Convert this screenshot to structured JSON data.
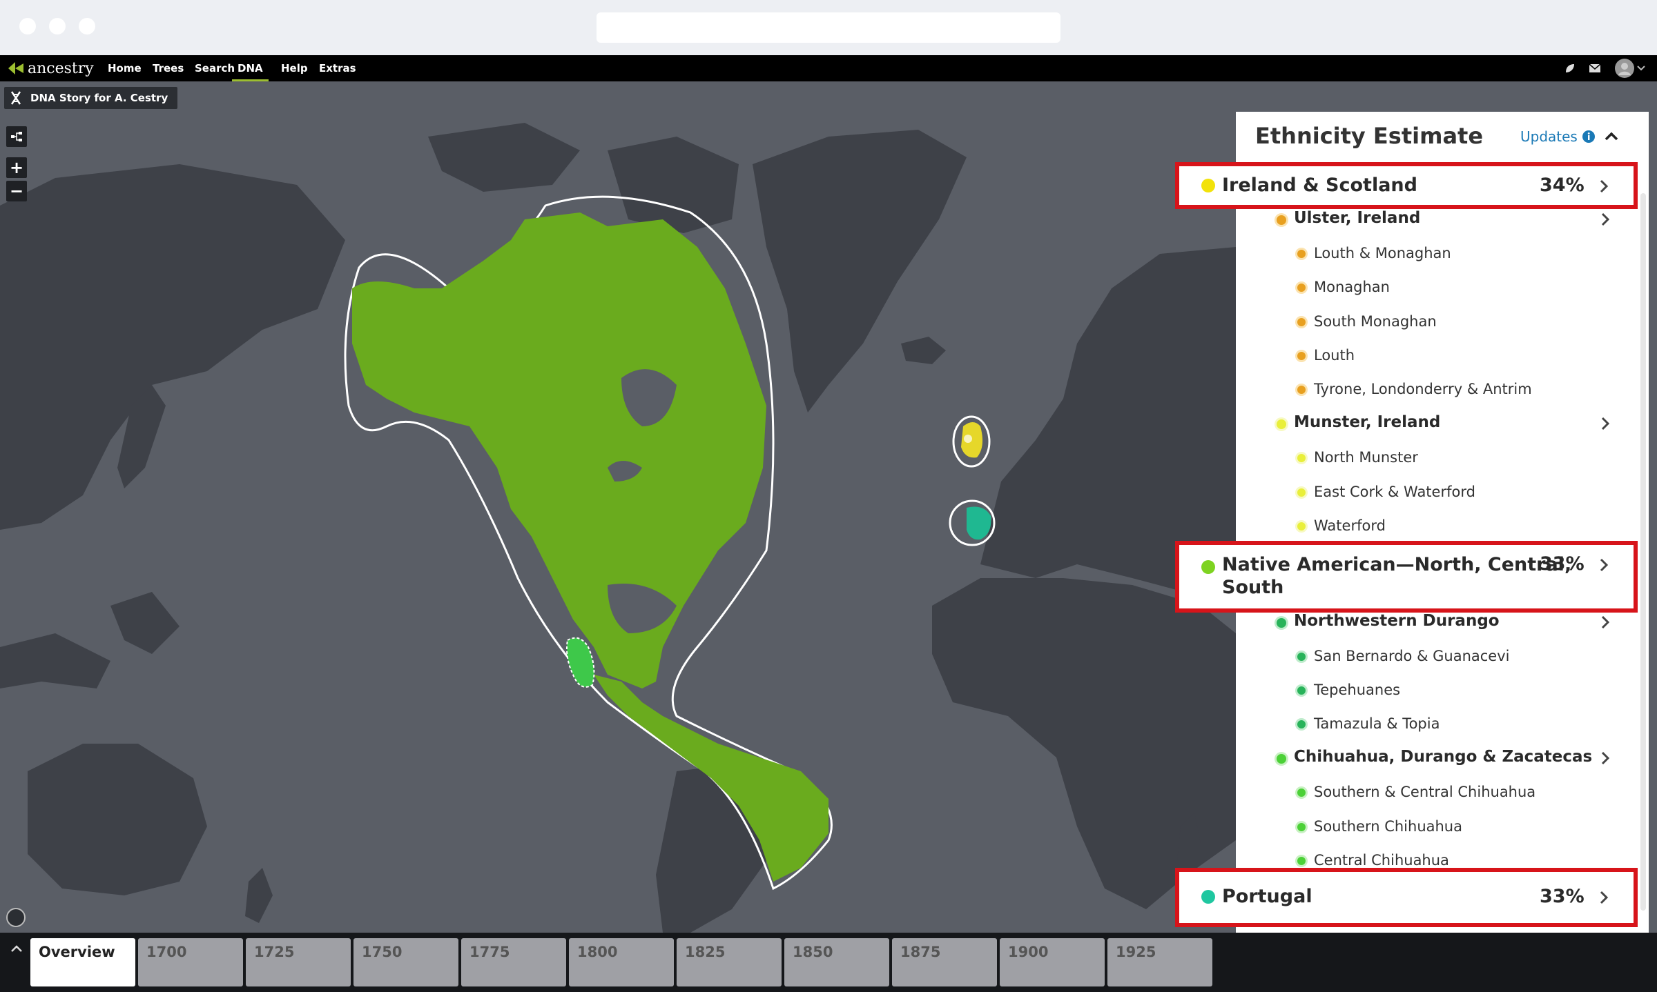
{
  "nav": {
    "logo": "ancestry",
    "links": [
      "Home",
      "Trees",
      "Search",
      "DNA",
      "Help",
      "Extras"
    ],
    "active": "DNA"
  },
  "story": {
    "label": "DNA Story for A. Cestry"
  },
  "map_controls": {
    "zoom_in": "+",
    "zoom_out": "−"
  },
  "panel": {
    "title": "Ethnicity Estimate",
    "updates_label": "Updates",
    "regions": [
      {
        "name": "Ireland & Scotland",
        "percent": "34%",
        "color": "#f2e20a",
        "sub": [
          {
            "name": "Ulster, Ireland",
            "color": "#e8a020",
            "items": [
              "Louth & Monaghan",
              "Monaghan",
              "South Monaghan",
              "Louth",
              "Tyrone, Londonderry & Antrim"
            ]
          },
          {
            "name": "Munster, Ireland",
            "color": "#e9ef3a",
            "items": [
              "North Munster",
              "East Cork & Waterford",
              "Waterford"
            ]
          }
        ]
      },
      {
        "name": "Native American—North, Central, South",
        "name_line1": "Native American—North, Central,",
        "name_line2": "South",
        "percent": "33%",
        "color": "#7ed321",
        "sub": [
          {
            "name": "Northwestern Durango",
            "color": "#28b35a",
            "items": [
              "San Bernardo & Guanacevi",
              "Tepehuanes",
              "Tamazula & Topia"
            ]
          },
          {
            "name": "Chihuahua, Durango & Zacatecas",
            "color": "#4cd137",
            "items": [
              "Southern & Central Chihuahua",
              "Southern Chihuahua",
              "Central Chihuahua"
            ]
          }
        ]
      },
      {
        "name": "Portugal",
        "percent": "33%",
        "color": "#1fc7a0"
      }
    ]
  },
  "timeline": {
    "tabs": [
      "Overview",
      "1700",
      "1725",
      "1750",
      "1775",
      "1800",
      "1825",
      "1850",
      "1875",
      "1900",
      "1925"
    ],
    "active": "Overview"
  },
  "colors": {
    "americas": "#6aab1e",
    "highlight": "#d7141a",
    "land": "#3d4047",
    "ocean": "#5a5e66"
  }
}
